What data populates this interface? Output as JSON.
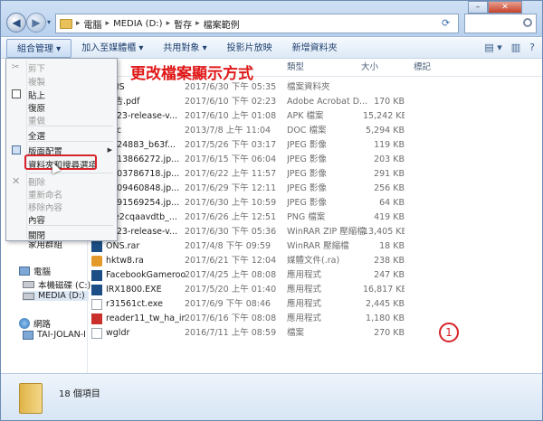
{
  "address": {
    "crumbs": [
      "電腦",
      "MEDIA (D:)",
      "暫存",
      "檔案範例"
    ]
  },
  "toolbar": {
    "organize": "組合管理 ▾",
    "add_to_library": "加入至媒體櫃 ▾",
    "share": "共用對象 ▾",
    "slideshow": "投影片放映",
    "new_folder": "新增資料夾"
  },
  "columns": {
    "type": "類型",
    "size": "大小",
    "tags": "標記"
  },
  "annotation": "更改檔案顯示方式",
  "marker": "1",
  "menu": {
    "items": [
      "剪下",
      "複製",
      "貼上",
      "復原",
      "重做",
      "全選",
      "版面配置",
      "資料夾和搜尋選項",
      "刪除",
      "重新命名",
      "移除內容",
      "內容",
      "關閉"
    ]
  },
  "sidebar": {
    "favorites_tail": "家用群組",
    "computer": "電腦",
    "drive_c": "本機磁碟 (C:)",
    "drive_d": "MEDIA (D:)",
    "network": "網路",
    "net_pc": "TAI-JOLAN-I"
  },
  "files": [
    {
      "name": "ONS",
      "date": "2017/6/30 下午 05:35",
      "type": "檔案資料夾",
      "size": "",
      "icon": "folder-icon"
    },
    {
      "name": "報告.pdf",
      "date": "2017/6/10 下午 02:23",
      "type": "Adobe Acrobat D...",
      "size": "170 KB",
      "icon": "pdf-icon"
    },
    {
      "name": "o123-release-v...",
      "date": "2017/6/10 上午 01:08",
      "type": "APK 檔案",
      "size": "15,242 KB",
      "icon": "apk-icon"
    },
    {
      "name": "doc",
      "date": "2013/7/8 上午 11:04",
      "type": "DOC 檔案",
      "size": "5,294 KB",
      "icon": "doc-icon"
    },
    {
      "name": "8824883_b63f...",
      "date": "2017/5/26 下午 03:17",
      "type": "JPEG 影像",
      "size": "119 KB",
      "icon": "jpeg-icon"
    },
    {
      "name": "7513866272.jp...",
      "date": "2017/6/15 下午 06:04",
      "type": "JPEG 影像",
      "size": "203 KB",
      "icon": "jpeg-icon"
    },
    {
      "name": "8103786718.jp...",
      "date": "2017/6/22 上午 11:57",
      "type": "JPEG 影像",
      "size": "291 KB",
      "icon": "jpeg-icon"
    },
    {
      "name": "8709460848.jp...",
      "date": "2017/6/29 下午 12:11",
      "type": "JPEG 影像",
      "size": "256 KB",
      "icon": "jpeg-icon"
    },
    {
      "name": "8791569254.jp...",
      "date": "2017/6/30 上午 10:59",
      "type": "JPEG 影像",
      "size": "64 KB",
      "icon": "jpeg-icon"
    },
    {
      "name": "cte2cqaavdtb_...",
      "date": "2017/6/26 上午 12:51",
      "type": "PNG 檔案",
      "size": "419 KB",
      "icon": "png-icon"
    },
    {
      "name": "o123-release-v...",
      "date": "2017/6/30 下午 05:36",
      "type": "WinRAR ZIP 壓縮檔",
      "size": "13,405 KB",
      "icon": "zip-icon"
    },
    {
      "name": "ONS.rar",
      "date": "2017/4/8 下午 09:59",
      "type": "WinRAR 壓縮檔",
      "size": "18 KB",
      "icon": "rar-icon"
    },
    {
      "name": "hktw8.ra",
      "date": "2017/6/21 下午 12:04",
      "type": "媒體文件(.ra)",
      "size": "238 KB",
      "icon": "ra-icon"
    },
    {
      "name": "FacebookGameroo...",
      "date": "2017/4/25 上午 08:08",
      "type": "應用程式",
      "size": "247 KB",
      "icon": "app-icon"
    },
    {
      "name": "IRX1800.EXE",
      "date": "2017/5/20 上午 01:40",
      "type": "應用程式",
      "size": "16,817 KB",
      "icon": "app-icon"
    },
    {
      "name": "r31561ct.exe",
      "date": "2017/6/9 下午 08:46",
      "type": "應用程式",
      "size": "2,445 KB",
      "icon": "app-icon"
    },
    {
      "name": "reader11_tw_ha_in...",
      "date": "2017/6/16 下午 08:08",
      "type": "應用程式",
      "size": "1,180 KB",
      "icon": "reader-icon"
    },
    {
      "name": "wgldr",
      "date": "2016/7/11 上午 08:59",
      "type": "檔案",
      "size": "270 KB",
      "icon": "file-icon"
    }
  ],
  "details": {
    "count": "18 個項目"
  }
}
